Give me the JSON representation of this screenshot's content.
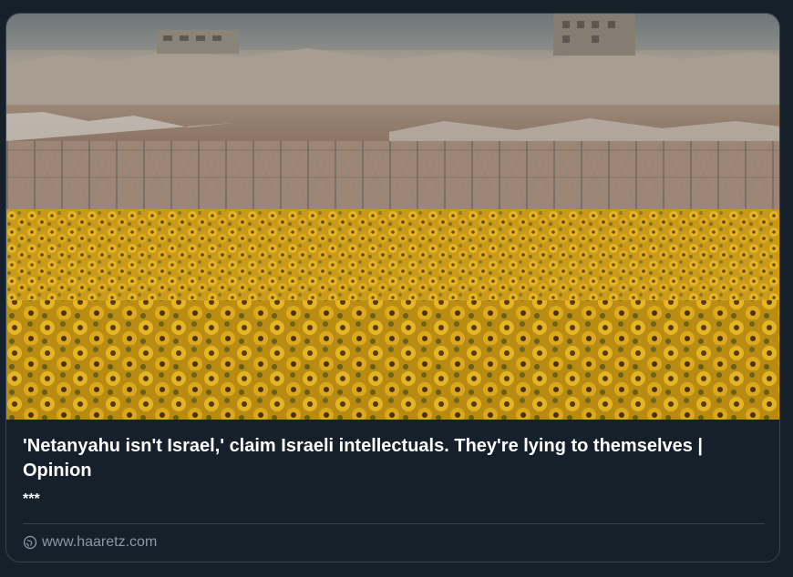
{
  "link_card": {
    "image_alt": "Sunflower field in front of a border fence and destroyed buildings",
    "title": "'Netanyahu isn't Israel,' claim Israeli intellectuals. They're lying to themselves | Opinion",
    "description": "***",
    "source_icon": "link-globe-icon",
    "source_domain": "www.haaretz.com"
  },
  "colors": {
    "background": "#15202b",
    "border": "#38444d",
    "title_text": "#ffffff",
    "muted_text": "#8b98a5",
    "sunflower": "#d9a81a"
  }
}
